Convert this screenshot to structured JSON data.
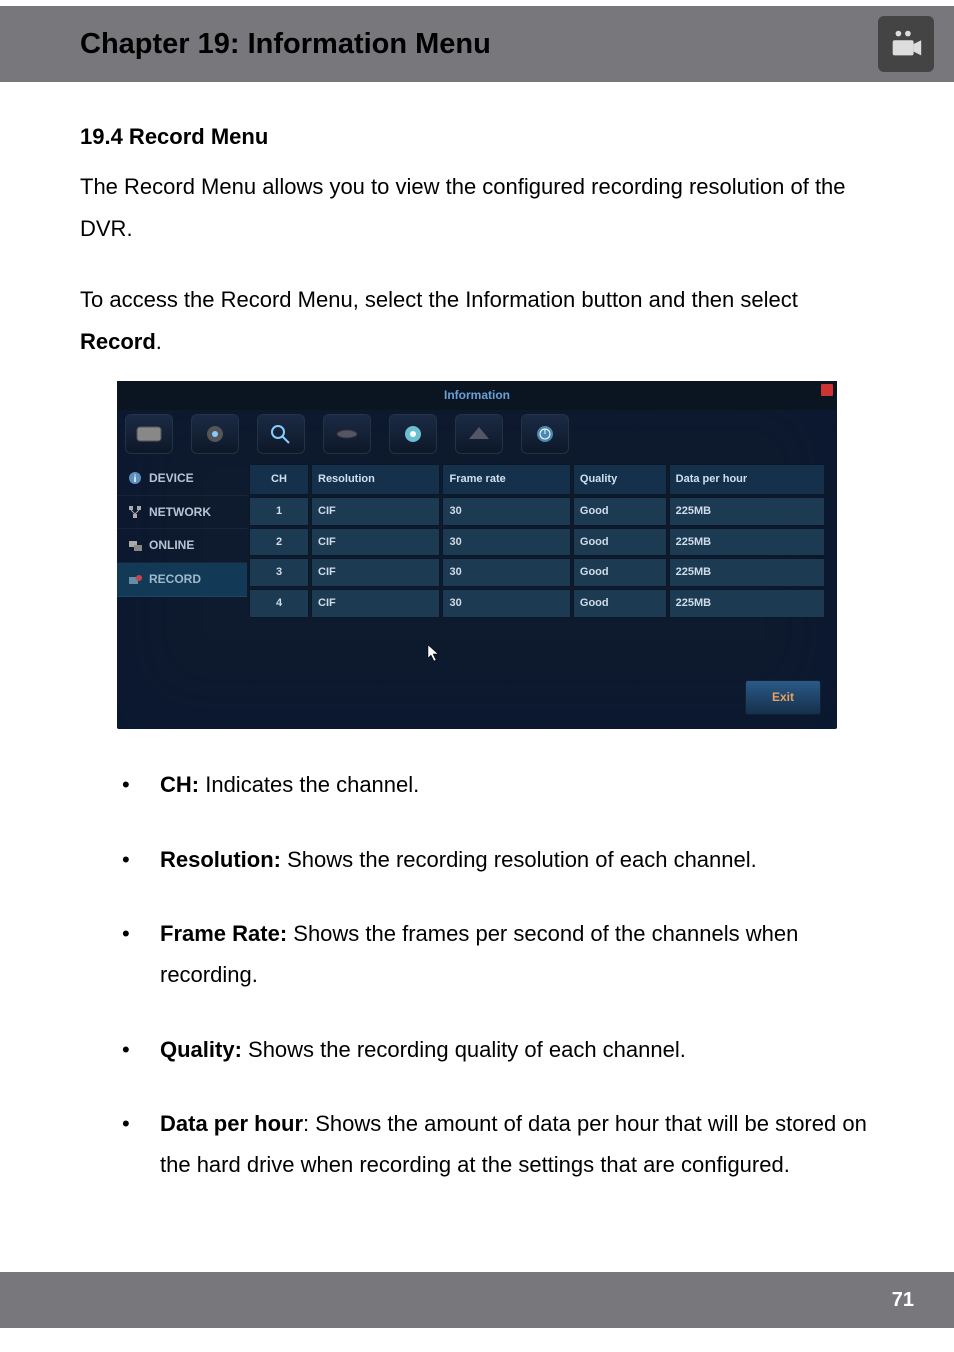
{
  "header": {
    "title": "Chapter 19: Information Menu"
  },
  "section": {
    "title": "19.4 Record Menu",
    "intro": "The Record Menu allows you to view the configured recording resolution of the DVR.",
    "instruction_pre": "To access the Record Menu, select the Information button and then select ",
    "instruction_bold": "Record",
    "instruction_post": "."
  },
  "screenshot": {
    "title": "Information",
    "sidebar": {
      "device": "DEVICE",
      "network": "NETWORK",
      "online": "ONLINE",
      "record": "RECORD"
    },
    "table": {
      "headers": {
        "ch": "CH",
        "resolution": "Resolution",
        "frame_rate": "Frame rate",
        "quality": "Quality",
        "data_per_hour": "Data per hour"
      },
      "rows": [
        {
          "ch": "1",
          "resolution": "CIF",
          "frame_rate": "30",
          "quality": "Good",
          "data_per_hour": "225MB"
        },
        {
          "ch": "2",
          "resolution": "CIF",
          "frame_rate": "30",
          "quality": "Good",
          "data_per_hour": "225MB"
        },
        {
          "ch": "3",
          "resolution": "CIF",
          "frame_rate": "30",
          "quality": "Good",
          "data_per_hour": "225MB"
        },
        {
          "ch": "4",
          "resolution": "CIF",
          "frame_rate": "30",
          "quality": "Good",
          "data_per_hour": "225MB"
        }
      ]
    },
    "exit": "Exit"
  },
  "bullets": {
    "ch": {
      "label": "CH:",
      "text": " Indicates the channel."
    },
    "resolution": {
      "label": "Resolution:",
      "text": " Shows the recording resolution of each channel."
    },
    "frame_rate": {
      "label": "Frame Rate:",
      "text": " Shows the frames per second of the channels when recording."
    },
    "quality": {
      "label": "Quality:",
      "text": " Shows the recording quality of each channel."
    },
    "data_per_hour": {
      "label": "Data per hour",
      "text": ": Shows the amount of data per hour that will be stored on the hard drive when recording at the settings that are configured."
    }
  },
  "footer": {
    "page": "71"
  }
}
